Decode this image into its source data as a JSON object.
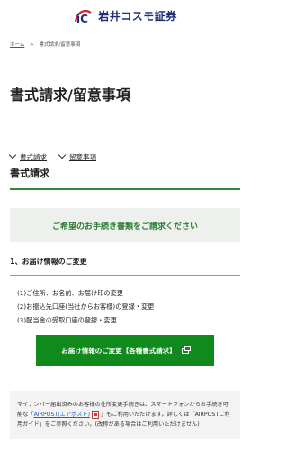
{
  "header": {
    "logo_text": "岩井コスモ証券"
  },
  "breadcrumb": {
    "home": "ホーム",
    "current": "書式請求/留意事項",
    "separator": ">"
  },
  "page": {
    "title": "書式請求/留意事項"
  },
  "anchors": [
    {
      "label": "書式請求"
    },
    {
      "label": "留意事項"
    }
  ],
  "section": {
    "title": "書式請求"
  },
  "notice": {
    "text": "ご希望のお手続き書類をご請求ください"
  },
  "subsection": {
    "title": "1、お届け情報のご変更"
  },
  "items": [
    "(1)ご住所、お名前、お届け印の変更",
    "(2)お振込先口座(当社からお客様)の登録・変更",
    "(3)配当金の受取口座の登録・変更"
  ],
  "cta": {
    "label": "お届け情報のご変更【各種書式請求】"
  },
  "info": {
    "part1": "マイナンバー届出済みのお客様の住所変更手続きは、スマートフォンからお手続き可能な「",
    "link": "AIRPOST(エアポスト)",
    "part2": "」もご利用いただけます。詳しくは「AIRPOSTご利用ガイド」をご参照ください。(改称がある場合はご利用いただけません)"
  },
  "colors": {
    "brand_green": "#118a1d",
    "heading_green": "#2b7d33",
    "logo_navy": "#1f2e7a"
  }
}
